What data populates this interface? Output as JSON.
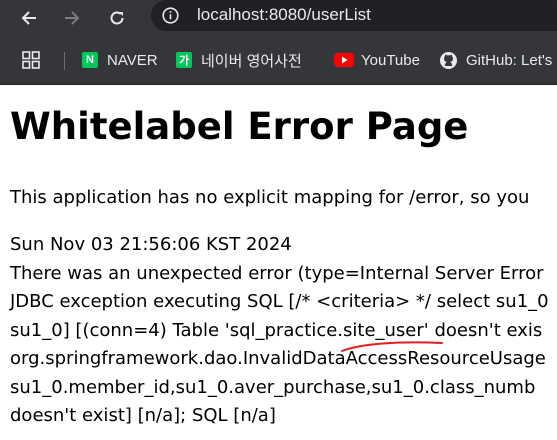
{
  "browser": {
    "url": "localhost:8080/userList",
    "bookmarks": [
      {
        "label": "NAVER",
        "icon": "naver-icon",
        "color": "#03c75a",
        "glyph": "N"
      },
      {
        "label": "네이버 영어사전",
        "icon": "naver-dictionary-icon",
        "color": "#03c75a",
        "glyph": "가"
      },
      {
        "label": "YouTube",
        "icon": "youtube-icon",
        "color": "#ff0000"
      },
      {
        "label": "GitHub: Let's",
        "icon": "github-icon"
      }
    ]
  },
  "page": {
    "title": "Whitelabel Error Page",
    "intro": "This application has no explicit mapping for /error, so you",
    "timestamp": "Sun Nov 03 21:56:06 KST 2024",
    "lines": [
      "There was an unexpected error (type=Internal Server Error",
      "JDBC exception executing SQL [/* <criteria> */ select su1_0",
      "su1_0] [(conn=4) Table 'sql_practice.site_user' doesn't exis",
      "org.springframework.dao.InvalidDataAccessResourceUsage",
      "su1_0.member_id,su1_0.aver_purchase,su1_0.class_numb",
      "doesn't exist] [n/a]; SQL [n/a]"
    ],
    "annotation_color": "#e02020"
  }
}
